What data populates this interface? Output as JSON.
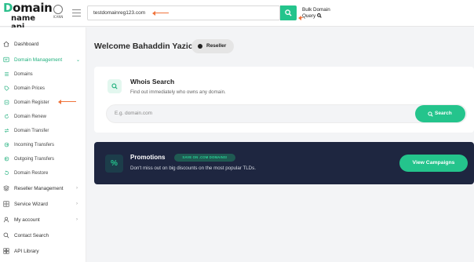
{
  "brand": {
    "logo_main_initial": "D",
    "logo_main_rest": "omain",
    "logo_sub": "name api",
    "accreditation": "ICANN"
  },
  "header": {
    "search_value": "testdomainreg123.com",
    "bulk_line1": "Bulk Domain",
    "bulk_line2": "Query"
  },
  "sidebar": {
    "items": [
      {
        "label": "Dashboard"
      },
      {
        "label": "Domain Management"
      },
      {
        "label": "Reseller Management"
      },
      {
        "label": "Service Wizard"
      },
      {
        "label": "My account"
      },
      {
        "label": "Contact Search"
      },
      {
        "label": "API Library"
      }
    ],
    "sub_items": [
      {
        "label": "Domains"
      },
      {
        "label": "Domain Prices"
      },
      {
        "label": "Domain Register"
      },
      {
        "label": "Domain Renew"
      },
      {
        "label": "Domain Transfer"
      },
      {
        "label": "Incoming Transfers"
      },
      {
        "label": "Outgoing Transfers"
      },
      {
        "label": "Domain Restore"
      }
    ]
  },
  "main": {
    "welcome": "Welcome Bahaddin Yazici",
    "role_badge": "Reseller",
    "whois": {
      "title": "Whois Search",
      "subtitle": "Find out immediately who owns any domain.",
      "placeholder": "E.g. domain.com",
      "button": "Search"
    },
    "promo": {
      "title": "Promotions",
      "badge": "SAVE ON .COM DOMAINS!",
      "subtitle": "Don't miss out on big discounts on the most popular TLDs.",
      "button": "View Campaigns",
      "icon_glyph": "%"
    }
  },
  "colors": {
    "accent": "#24c48c",
    "annotation_arrow": "#f0743c",
    "promo_bg": "#1e2640"
  }
}
